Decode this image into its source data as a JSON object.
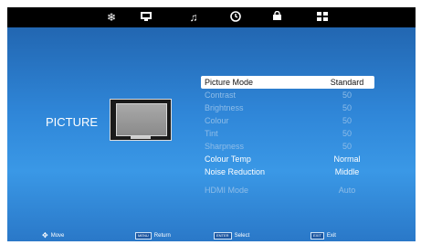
{
  "top_tabs": [
    {
      "icon": "snowflake-icon",
      "glyph": "❄"
    },
    {
      "icon": "monitor-icon",
      "glyph": "🖵"
    },
    {
      "icon": "music-note-icon",
      "glyph": "♫"
    },
    {
      "icon": "clock-icon",
      "glyph": "◷"
    },
    {
      "icon": "lock-icon",
      "glyph": "🔒"
    },
    {
      "icon": "grid-icon",
      "glyph": "▦"
    }
  ],
  "section": {
    "title": "PICTURE"
  },
  "menu": {
    "items": [
      {
        "label": "Picture Mode",
        "value": "Standard",
        "state": "selected"
      },
      {
        "label": "Contrast",
        "value": "50",
        "state": "dim"
      },
      {
        "label": "Brightness",
        "value": "50",
        "state": "dim"
      },
      {
        "label": "Colour",
        "value": "50",
        "state": "dim"
      },
      {
        "label": "Tint",
        "value": "50",
        "state": "dim"
      },
      {
        "label": "Sharpness",
        "value": "50",
        "state": "dim"
      },
      {
        "label": "Colour Temp",
        "value": "Normal",
        "state": "normal"
      },
      {
        "label": "Noise Reduction",
        "value": "Middle",
        "state": "normal"
      },
      {
        "label": "HDMI Mode",
        "value": "Auto",
        "state": "dim"
      }
    ]
  },
  "bottom": {
    "move_label": "Move",
    "menu_key": "MENU",
    "return_label": "Return",
    "enter_key": "ENTER",
    "select_label": "Select",
    "exit_key": "EXIT",
    "exit_label": "Exit"
  }
}
